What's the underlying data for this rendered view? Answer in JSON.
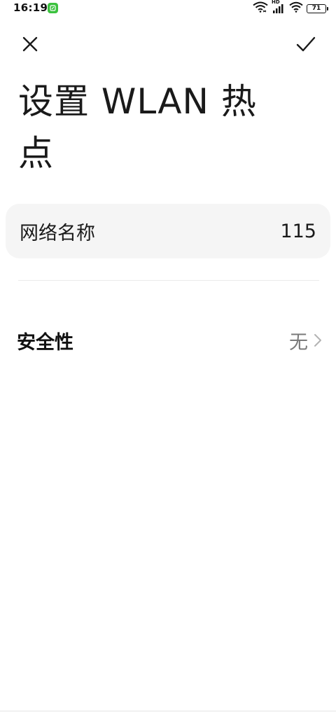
{
  "status_bar": {
    "time": "16:19",
    "app_icon": "green-notification-icon",
    "hd_badge": "HD",
    "battery_level": "71",
    "battery_fraction": 0.71
  },
  "header": {
    "close_icon": "close-icon",
    "confirm_icon": "check-icon"
  },
  "title": "设置 WLAN 热点",
  "network": {
    "label": "网络名称",
    "value": "115"
  },
  "security": {
    "label": "安全性",
    "value": "无",
    "chevron_icon": "chevron-right-icon"
  },
  "colors": {
    "card_background": "#f5f5f5",
    "secondary_text": "#7a7a7a",
    "app_icon_green": "#3cc23f"
  }
}
